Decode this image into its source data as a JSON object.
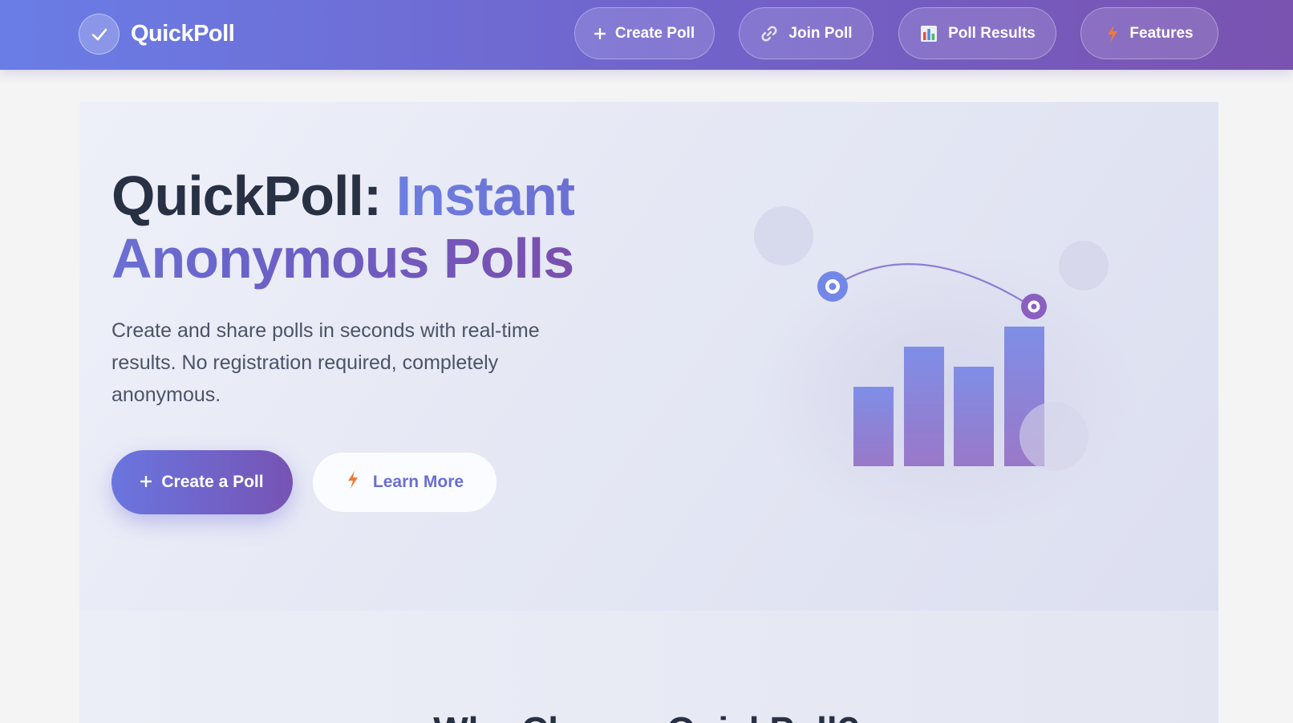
{
  "brand": {
    "name": "QuickPoll",
    "logo_icon": "check-icon"
  },
  "nav": [
    {
      "label": "Create Poll",
      "icon": "plus-icon"
    },
    {
      "label": "Join Poll",
      "icon": "link-icon"
    },
    {
      "label": "Poll Results",
      "icon": "bar-chart-icon"
    },
    {
      "label": "Features",
      "icon": "lightning-icon"
    }
  ],
  "hero": {
    "title_part1": "QuickPoll: ",
    "title_part2": "Instant Anonymous Polls",
    "subtitle": "Create and share polls in seconds with real-time results. No registration required, completely anonymous.",
    "primary_button": {
      "label": "Create a Poll",
      "icon": "plus-icon"
    },
    "secondary_button": {
      "label": "Learn More",
      "icon": "lightning-icon"
    }
  },
  "next_section": {
    "heading": "Why Choose QuickPoll?"
  },
  "colors": {
    "header_gradient_start": "#6a7de6",
    "header_gradient_end": "#7a53b0",
    "text_dark": "#283044",
    "accent_blue": "#6d7fe0",
    "accent_purple": "#7a4fae",
    "lightning_orange": "#f07a3a"
  }
}
